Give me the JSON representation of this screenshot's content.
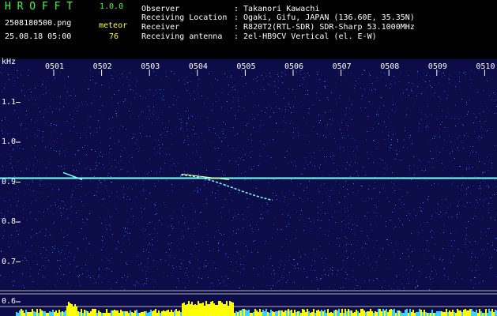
{
  "app": {
    "name": "H R O F F T",
    "version": "1.0.0"
  },
  "file": {
    "name": "2508180500.png",
    "datetime": "25.08.18 05:00"
  },
  "counter": {
    "label": "meteor",
    "value": "76"
  },
  "info": [
    {
      "key": "Observer",
      "value": ": Takanori Kawachi"
    },
    {
      "key": "Receiving Location",
      "value": ": Ogaki, Gifu, JAPAN (136.60E, 35.35N)"
    },
    {
      "key": "Receiver",
      "value": ": R820T2(RTL-SDR) SDR-Sharp 53.1000MHz"
    },
    {
      "key": "Receiving antenna",
      "value": ": 2el-HB9CV Vertical (el. E-W)"
    }
  ],
  "chart_data": {
    "type": "heatmap",
    "ylabel": "kHz",
    "x_ticks": [
      "0501",
      "0502",
      "0503",
      "0504",
      "0505",
      "0506",
      "0507",
      "0508",
      "0509",
      "0510"
    ],
    "y_ticks": [
      {
        "label": "1.1",
        "value": 1.1
      },
      {
        "label": "1.0",
        "value": 1.0
      },
      {
        "label": "0.9",
        "value": 0.9
      },
      {
        "label": "0.8",
        "value": 0.8
      },
      {
        "label": "0.7",
        "value": 0.7
      },
      {
        "label": "0.6",
        "value": 0.6
      }
    ],
    "carrier_khz": 0.91,
    "colors": {
      "background": "#0c0c48",
      "noise": "#3a5cff",
      "signal": "#7dffff",
      "level": "#ffff00",
      "level_low": "#40d0ff"
    }
  }
}
